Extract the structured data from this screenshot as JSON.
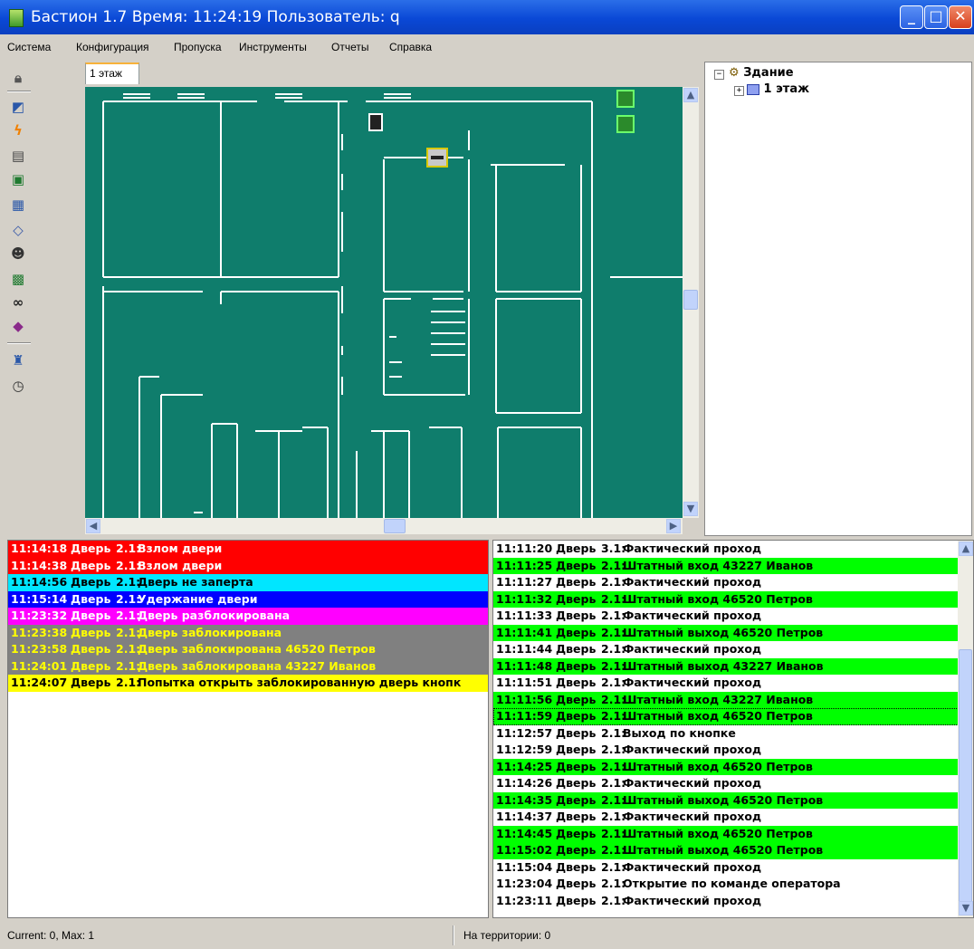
{
  "window": {
    "title": "Бастион 1.7 Время: 11:24:19 Пользователь: q"
  },
  "menu": [
    "Система",
    "Конфигурация",
    "Пропуска",
    "Инструменты",
    "Отчеты",
    "Справка"
  ],
  "toolbar": {
    "icons": [
      "lock-icon",
      "camera-icon",
      "lightning-icon",
      "documents-icon",
      "map-icon",
      "card-icon",
      "eraser-icon",
      "person-icon",
      "report-icon",
      "binoculars-icon",
      "book-icon",
      "guard-icon",
      "timer-icon"
    ]
  },
  "map": {
    "tab": "1 этаж",
    "background": "#0f7d6c"
  },
  "tree": {
    "root": "Здание",
    "child": "1 этаж"
  },
  "alarms": [
    {
      "time": "11:14:18",
      "dev": "Дверь",
      "num": "2.1:",
      "msg": "Взлом двери",
      "bg": "#ff0000",
      "fg": "#ffffff"
    },
    {
      "time": "11:14:38",
      "dev": "Дверь",
      "num": "2.1:",
      "msg": "Взлом двери",
      "bg": "#ff0000",
      "fg": "#ffffff"
    },
    {
      "time": "11:14:56",
      "dev": "Дверь",
      "num": "2.1:",
      "msg": "Дверь не заперта",
      "bg": "#00e6ff",
      "fg": "#000000"
    },
    {
      "time": "11:15:14",
      "dev": "Дверь",
      "num": "2.1:",
      "msg": "Удержание двери",
      "bg": "#0000ff",
      "fg": "#ffffff"
    },
    {
      "time": "11:23:32",
      "dev": "Дверь",
      "num": "2.1:",
      "msg": "Дверь разблокирована",
      "bg": "#ff00ff",
      "fg": "#ffffff"
    },
    {
      "time": "11:23:38",
      "dev": "Дверь",
      "num": "2.1:",
      "msg": "Дверь заблокирована",
      "bg": "#808080",
      "fg": "#ffff00"
    },
    {
      "time": "11:23:58",
      "dev": "Дверь",
      "num": "2.1:",
      "msg": "Дверь заблокирована 46520 Петров",
      "bg": "#808080",
      "fg": "#ffff00"
    },
    {
      "time": "11:24:01",
      "dev": "Дверь",
      "num": "2.1:",
      "msg": "Дверь заблокирована 43227 Иванов",
      "bg": "#808080",
      "fg": "#ffff00"
    },
    {
      "time": "11:24:07",
      "dev": "Дверь",
      "num": "2.1:",
      "msg": "Попытка открыть заблокированную дверь кнопк",
      "bg": "#ffff00",
      "fg": "#000000"
    }
  ],
  "events": [
    {
      "time": "11:11:20",
      "dev": "Дверь",
      "num": "3.1:",
      "msg": "Фактический проход",
      "bg": "#ffffff"
    },
    {
      "time": "11:11:25",
      "dev": "Дверь",
      "num": "2.1:",
      "msg": "Штатный вход 43227 Иванов",
      "bg": "#00ff00"
    },
    {
      "time": "11:11:27",
      "dev": "Дверь",
      "num": "2.1:",
      "msg": "Фактический проход",
      "bg": "#ffffff"
    },
    {
      "time": "11:11:32",
      "dev": "Дверь",
      "num": "2.1:",
      "msg": "Штатный вход 46520 Петров",
      "bg": "#00ff00"
    },
    {
      "time": "11:11:33",
      "dev": "Дверь",
      "num": "2.1:",
      "msg": "Фактический проход",
      "bg": "#ffffff"
    },
    {
      "time": "11:11:41",
      "dev": "Дверь",
      "num": "2.1:",
      "msg": "Штатный выход 46520 Петров",
      "bg": "#00ff00"
    },
    {
      "time": "11:11:44",
      "dev": "Дверь",
      "num": "2.1:",
      "msg": "Фактический проход",
      "bg": "#ffffff"
    },
    {
      "time": "11:11:48",
      "dev": "Дверь",
      "num": "2.1:",
      "msg": "Штатный выход 43227 Иванов",
      "bg": "#00ff00"
    },
    {
      "time": "11:11:51",
      "dev": "Дверь",
      "num": "2.1:",
      "msg": "Фактический проход",
      "bg": "#ffffff"
    },
    {
      "time": "11:11:56",
      "dev": "Дверь",
      "num": "2.1:",
      "msg": "Штатный вход 43227 Иванов",
      "bg": "#00ff00"
    },
    {
      "time": "11:11:59",
      "dev": "Дверь",
      "num": "2.1:",
      "msg": "Штатный вход 46520 Петров",
      "bg": "#00ff00",
      "selected": true
    },
    {
      "time": "11:12:57",
      "dev": "Дверь",
      "num": "2.1:",
      "msg": "Выход по кнопке",
      "bg": "#ffffff"
    },
    {
      "time": "11:12:59",
      "dev": "Дверь",
      "num": "2.1:",
      "msg": "Фактический проход",
      "bg": "#ffffff"
    },
    {
      "time": "11:14:25",
      "dev": "Дверь",
      "num": "2.1:",
      "msg": "Штатный вход 46520 Петров",
      "bg": "#00ff00"
    },
    {
      "time": "11:14:26",
      "dev": "Дверь",
      "num": "2.1:",
      "msg": "Фактический проход",
      "bg": "#ffffff"
    },
    {
      "time": "11:14:35",
      "dev": "Дверь",
      "num": "2.1:",
      "msg": "Штатный выход 46520 Петров",
      "bg": "#00ff00"
    },
    {
      "time": "11:14:37",
      "dev": "Дверь",
      "num": "2.1:",
      "msg": "Фактический проход",
      "bg": "#ffffff"
    },
    {
      "time": "11:14:45",
      "dev": "Дверь",
      "num": "2.1:",
      "msg": "Штатный вход 46520 Петров",
      "bg": "#00ff00"
    },
    {
      "time": "11:15:02",
      "dev": "Дверь",
      "num": "2.1:",
      "msg": "Штатный выход 46520 Петров",
      "bg": "#00ff00"
    },
    {
      "time": "11:15:04",
      "dev": "Дверь",
      "num": "2.1:",
      "msg": "Фактический проход",
      "bg": "#ffffff"
    },
    {
      "time": "11:23:04",
      "dev": "Дверь",
      "num": "2.1:",
      "msg": "Открытие по команде оператора",
      "bg": "#ffffff"
    },
    {
      "time": "11:23:11",
      "dev": "Дверь",
      "num": "2.1:",
      "msg": "Фактический проход",
      "bg": "#ffffff"
    }
  ],
  "status": {
    "left": "Current: 0, Max: 1",
    "right": "На территории: 0"
  }
}
